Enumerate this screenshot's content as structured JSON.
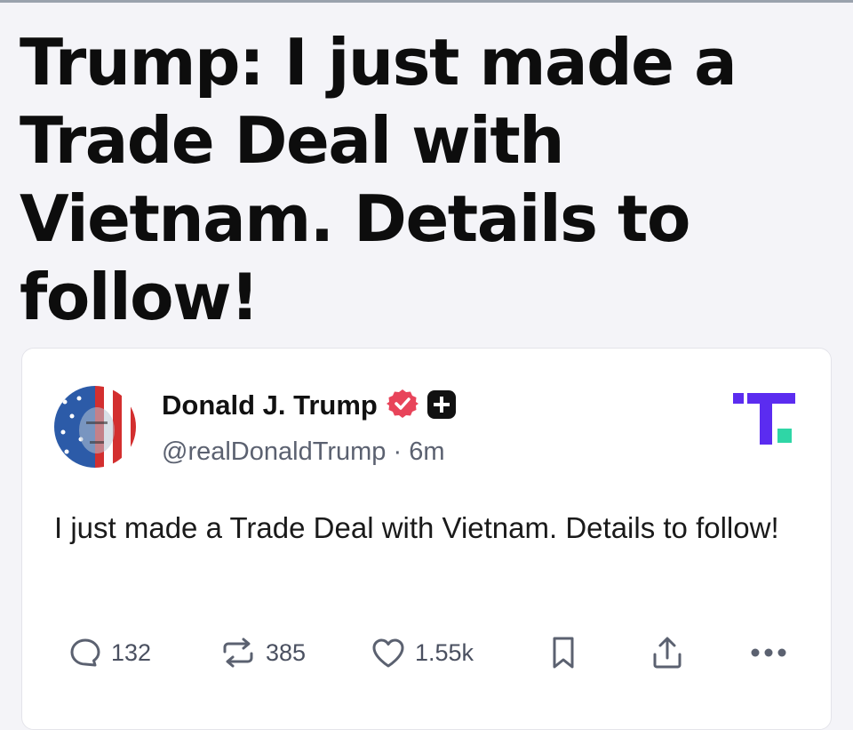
{
  "headline": "Trump: I just made a Trade Deal with Vietnam. Details to follow!",
  "post": {
    "author_name": "Donald J. Trump",
    "handle": "@realDonaldTrump",
    "separator": "·",
    "time_ago": "6m",
    "body": "I just made a Trade Deal with Vietnam. Details to follow!",
    "actions": {
      "replies": "132",
      "reposts": "385",
      "likes": "1.55k"
    }
  },
  "colors": {
    "page_background": "#f4f4f8",
    "verified_badge": "#e8445a",
    "brand_primary": "#5b2cf0",
    "brand_accent": "#2fd6a6",
    "text_secondary": "#5b6170"
  },
  "icons": {
    "verified": "verified-badge-icon",
    "plus": "plus-badge-icon",
    "brand": "truth-social-logo",
    "reply": "reply-icon",
    "repost": "repost-icon",
    "like": "heart-icon",
    "bookmark": "bookmark-icon",
    "share": "share-icon",
    "more": "more-options-icon"
  }
}
